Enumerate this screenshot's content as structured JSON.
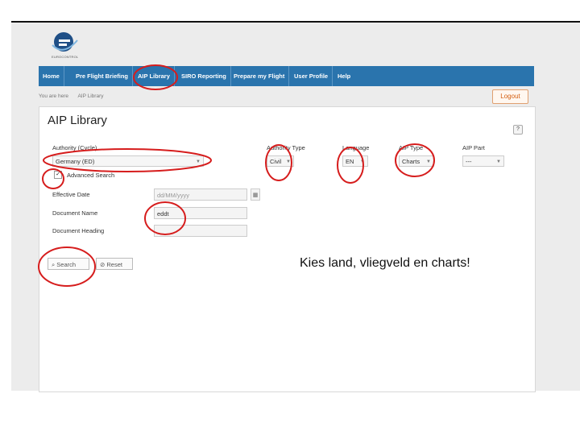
{
  "header": {
    "logo_alt": "EUROCONTROL logo",
    "logo_text": "EUROCONTROL"
  },
  "nav": {
    "items": [
      "Home",
      "Pre Flight Briefing",
      "AIP Library",
      "SIRO Reporting",
      "Prepare my Flight",
      "User Profile",
      "Help"
    ]
  },
  "breadcrumb": {
    "prefix": "You are here",
    "current": "AIP Library"
  },
  "logout_label": "Logout",
  "page": {
    "title": "AIP Library",
    "help": "?"
  },
  "form": {
    "authority_label": "Authority (Cycle)",
    "authority_value": "Germany (ED)",
    "authority_type_label": "Authority Type",
    "authority_type_value": "Civil",
    "language_label": "Language",
    "language_value": "EN",
    "aip_type_label": "AIP Type",
    "aip_type_value": "Charts",
    "aip_part_label": "AIP Part",
    "aip_part_value": "---",
    "advanced_search_label": "Advanced Search",
    "effective_date_label": "Effective Date",
    "effective_date_placeholder": "dd/MM/yyyy",
    "document_name_label": "Document Name",
    "document_name_value": "eddt",
    "document_heading_label": "Document Heading",
    "search_label": "Search",
    "reset_label": "Reset"
  },
  "annotation": "Kies land, vliegveld en charts!",
  "colors": {
    "nav": "#2a74ad",
    "highlight": "#d61d1d",
    "logout": "#d35d10"
  }
}
